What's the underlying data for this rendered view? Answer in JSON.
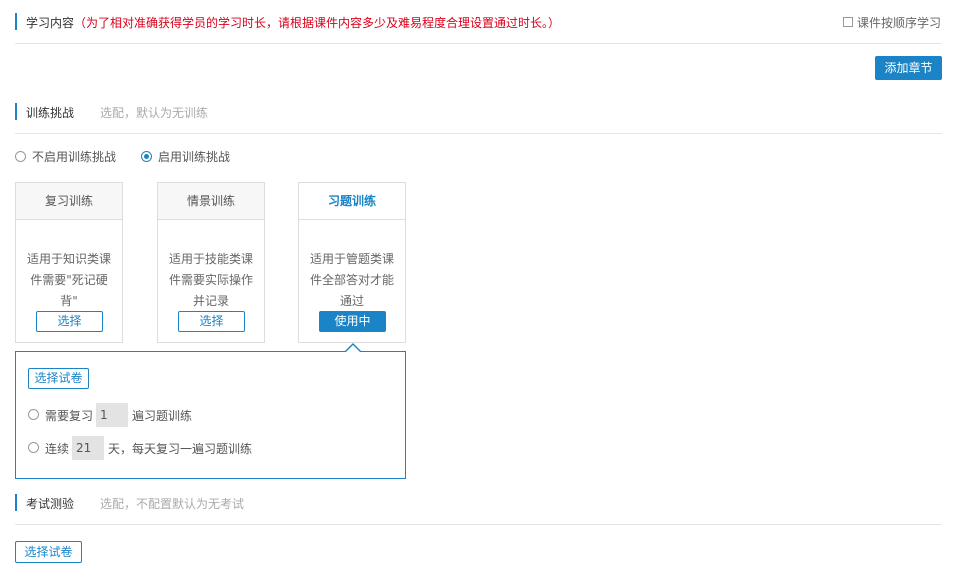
{
  "study_content": {
    "title": "学习内容",
    "note": "（为了相对准确获得学员的学习时长，请根据课件内容多少及难易程度合理设置通过时长。）",
    "sequential_checkbox_label": "课件按顺序学习",
    "add_chapter_button": "添加章节"
  },
  "training": {
    "title": "训练挑战",
    "hint": "选配，默认为无训练",
    "radio_disable_label": "不启用训练挑战",
    "radio_enable_label": "启用训练挑战",
    "selected_option": "启用训练挑战",
    "cards": [
      {
        "title": "复习训练",
        "desc_lines": [
          "适用于知识类课",
          "件需要\"死记硬",
          "背\""
        ],
        "button": "选择",
        "active": false
      },
      {
        "title": "情景训练",
        "desc_lines": [
          "适用于技能类课",
          "件需要实际操作",
          "并记录"
        ],
        "button": "选择",
        "active": false
      },
      {
        "title": "习题训练",
        "desc_lines": [
          "适用于管题类课",
          "件全部答对才能",
          "通过"
        ],
        "button": "使用中",
        "active": true
      }
    ],
    "panel": {
      "select_paper_button": "选择试卷",
      "option1": {
        "prefix": "需要复习",
        "value": "1",
        "suffix": "遍习题训练"
      },
      "option2": {
        "prefix": "连续",
        "value": "21",
        "suffix": "天，每天复习一遍习题训练"
      }
    }
  },
  "exam": {
    "title": "考试测验",
    "hint": "选配，不配置默认为无考试",
    "select_paper_button": "选择试卷"
  },
  "colors": {
    "accent": "#1a84c6",
    "note_red": "#d9001b"
  }
}
